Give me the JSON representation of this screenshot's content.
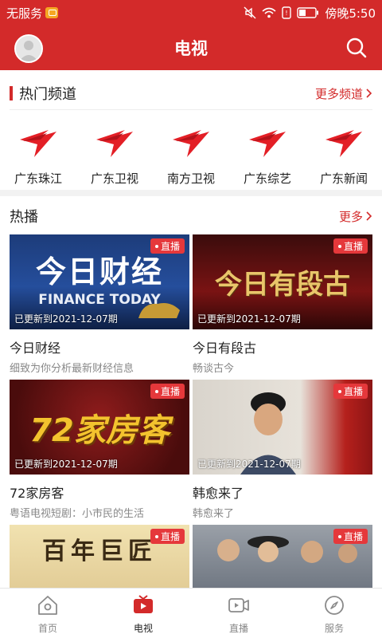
{
  "statusbar": {
    "carrier": "无服务",
    "time": "傍晚5:50"
  },
  "header": {
    "title": "电视"
  },
  "hot_channels": {
    "title": "热门频道",
    "more": "更多频道",
    "items": [
      {
        "name": "广东珠江"
      },
      {
        "name": "广东卫视"
      },
      {
        "name": "南方卫视"
      },
      {
        "name": "广东综艺"
      },
      {
        "name": "广东新闻"
      }
    ]
  },
  "hot_play": {
    "title": "热播",
    "more": "更多",
    "cards": [
      {
        "title": "今日财经",
        "subtitle": "细致为你分析最新财经信息",
        "badge": "直播",
        "updated": "已更新到2021-12-07期",
        "art_line1": "今日财经",
        "art_line2": "FINANCE TODAY"
      },
      {
        "title": "今日有段古",
        "subtitle": "畅谈古今",
        "badge": "直播",
        "updated": "已更新到2021-12-07期",
        "art_line1": "今日有段古",
        "art_line2": ""
      },
      {
        "title": "72家房客",
        "subtitle": "粤语电视短剧：小市民的生活",
        "badge": "直播",
        "updated": "已更新到2021-12-07期",
        "art_line1": "72家房客",
        "art_line2": ""
      },
      {
        "title": "韩愈来了",
        "subtitle": "韩愈来了",
        "badge": "直播",
        "updated": "已更新到2021-12-07期",
        "art_line1": "",
        "art_line2": ""
      },
      {
        "title": "",
        "subtitle": "",
        "badge": "直播",
        "updated": "",
        "art_line1": "百年巨匠",
        "art_line2": ""
      },
      {
        "title": "",
        "subtitle": "",
        "badge": "直播",
        "updated": "",
        "art_line1": "",
        "art_line2": ""
      }
    ]
  },
  "bottom_nav": {
    "items": [
      {
        "label": "首页"
      },
      {
        "label": "电视"
      },
      {
        "label": "直播"
      },
      {
        "label": "服务"
      }
    ],
    "active_index": 1
  },
  "colors": {
    "brand_red": "#d32a2a",
    "badge_red": "#e5383b",
    "muted_text": "#888888"
  }
}
